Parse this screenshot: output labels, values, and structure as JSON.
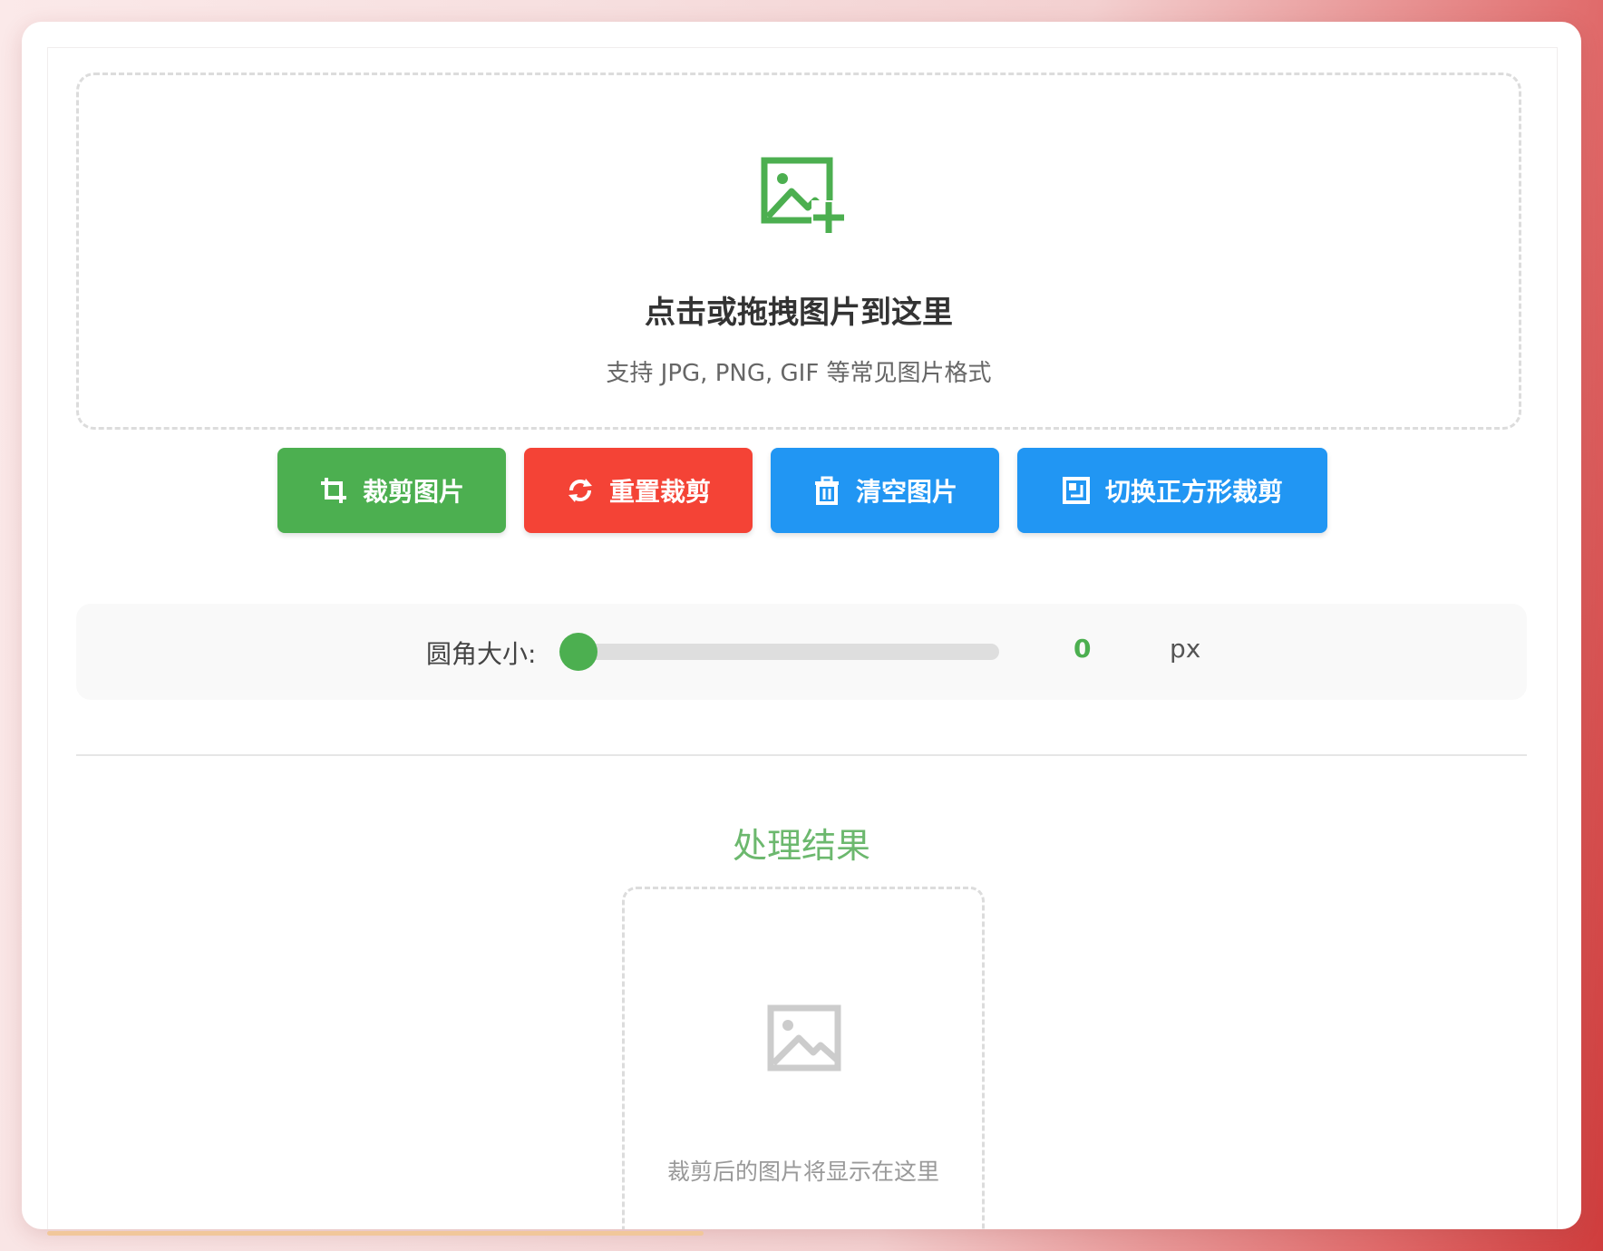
{
  "upload": {
    "icon": "image-add-icon",
    "title": "点击或拖拽图片到这里",
    "subtitle": "支持 JPG, PNG, GIF 等常见图片格式"
  },
  "buttons": {
    "crop": {
      "label": "裁剪图片",
      "icon": "crop-icon",
      "color": "#4caf50"
    },
    "reset": {
      "label": "重置裁剪",
      "icon": "refresh-icon",
      "color": "#f44336"
    },
    "clear": {
      "label": "清空图片",
      "icon": "trash-icon",
      "color": "#2196f3"
    },
    "square": {
      "label": "切换正方形裁剪",
      "icon": "square-crop-icon",
      "color": "#2196f3"
    }
  },
  "radius": {
    "label": "圆角大小:",
    "value": "0",
    "unit": "px",
    "fraction": 0.0
  },
  "result": {
    "title": "处理结果",
    "icon": "image-placeholder-icon",
    "placeholder": "裁剪后的图片将显示在这里"
  }
}
